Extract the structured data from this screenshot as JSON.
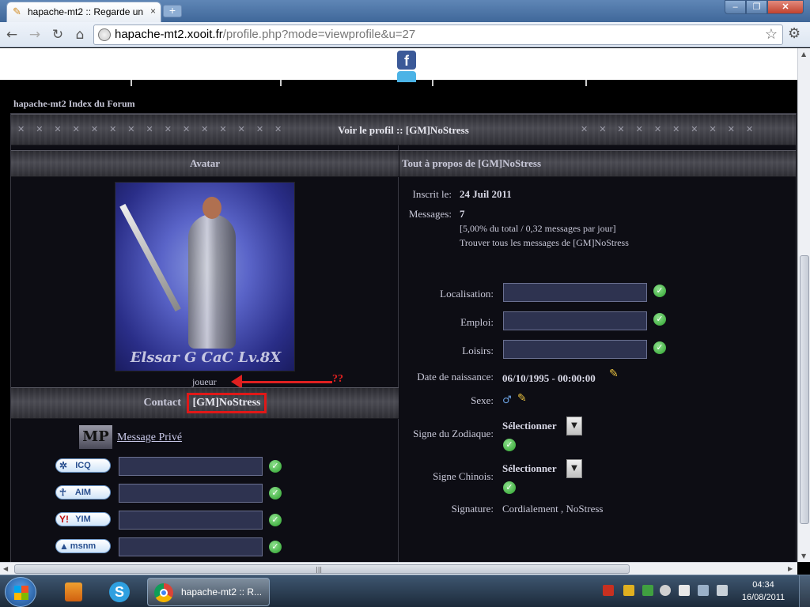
{
  "browser": {
    "tab_title": "hapache-mt2 :: Regarde un",
    "tab_close": "×",
    "new_tab": "+",
    "url_host": "hapache-mt2.xooit.fr",
    "url_path": "/profile.php?mode=viewprofile&u=27",
    "win_min": "–",
    "win_max": "❐",
    "win_close": "✕"
  },
  "icons": {
    "back": "arrow-left-icon",
    "forward": "arrow-right-icon",
    "reload": "reload-icon",
    "home": "home-icon",
    "star": "star-icon",
    "wrench": "wrench-icon",
    "facebook": "facebook-icon",
    "twitter": "twitter-icon",
    "check": "check-icon",
    "edit": "pencil-icon",
    "gender": "male-icon"
  },
  "glyphs": {
    "back": "←",
    "forward": "→",
    "reload": "↻",
    "home": "⌂",
    "star": "☆",
    "wrench": "🔧",
    "check": "✓",
    "edit": "✎",
    "gender": "♂",
    "dropdown": "▼",
    "facebook": "f",
    "rivets": "✕✕✕✕✕✕✕✕✕✕✕✕✕✕✕",
    "rivets_right": "✕✕✕✕✕✕✕✕✕✕"
  },
  "forum": {
    "breadcrumb": "hapache-mt2 Index du Forum",
    "profile_title": "Voir le profil :: [GM]NoStress",
    "avatar_header": "Avatar",
    "about_header": "Tout à propos de [GM]NoStress",
    "avatar_caption": "Elssar G CaC Lv.8X",
    "rank": "joueur",
    "annotation": "??",
    "contact_prefix": "Contact",
    "contact_name": "[GM]NoStress",
    "private_message": "Message Privé",
    "mp_badge": "MP",
    "im": [
      {
        "label": "ICQ",
        "symbol": "✲",
        "value": ""
      },
      {
        "label": "AIM",
        "symbol": "☥",
        "value": ""
      },
      {
        "label": "YIM",
        "symbol": "Y!",
        "value": ""
      },
      {
        "label": "msnm",
        "symbol": "▲",
        "value": ""
      }
    ]
  },
  "about": {
    "joined_label": "Inscrit le:",
    "joined_value": "24 Juil 2011",
    "messages_label": "Messages:",
    "messages_value": "7",
    "messages_stats": "[5,00% du total / 0,32 messages par jour]",
    "find_posts": "Trouver tous les messages de [GM]NoStress",
    "location_label": "Localisation:",
    "location_value": "",
    "job_label": "Emploi:",
    "job_value": "",
    "hobbies_label": "Loisirs:",
    "hobbies_value": "",
    "birthdate_label": "Date de naissance:",
    "birthdate_value": "06/10/1995 - 00:00:00",
    "gender_label": "Sexe:",
    "zodiac_label": "Signe du Zodiaque:",
    "zodiac_value": "Sélectionner",
    "chinese_label": "Signe Chinois:",
    "chinese_value": "Sélectionner",
    "signature_label": "Signature:",
    "signature_value": "Cordialement , NoStress"
  },
  "taskbar": {
    "task_label": "hapache-mt2 :: R...",
    "skype_letter": "S",
    "time": "04:34",
    "date": "16/08/2011"
  },
  "scroll": {
    "up": "▲",
    "down": "▼",
    "left": "◀",
    "right": "▶",
    "grip": "|||"
  },
  "colors": {
    "accent_red": "#e02020",
    "check_green": "#2aa02a",
    "field_bg": "#2e3350"
  }
}
